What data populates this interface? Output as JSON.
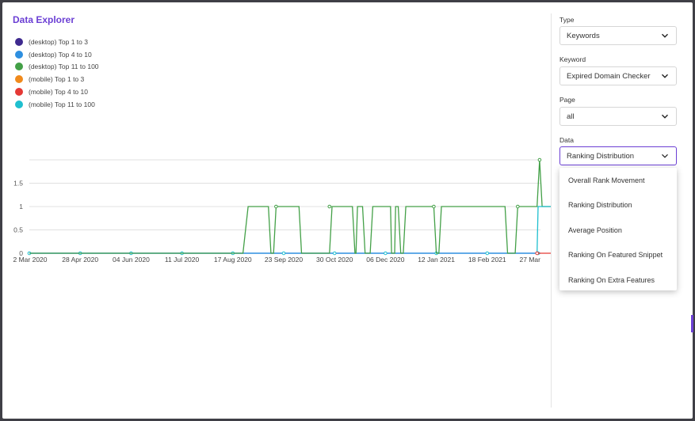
{
  "title": "Data Explorer",
  "legend": [
    {
      "label": "(desktop) Top 1 to 3",
      "color": "#3f2a8f"
    },
    {
      "label": "(desktop) Top 4 to 10",
      "color": "#2e8fe0"
    },
    {
      "label": "(desktop) Top 11 to 100",
      "color": "#43a047"
    },
    {
      "label": "(mobile) Top 1 to 3",
      "color": "#f08a1c"
    },
    {
      "label": "(mobile) Top 4 to 10",
      "color": "#e53935"
    },
    {
      "label": "(mobile) Top 11 to 100",
      "color": "#1fbfcf"
    }
  ],
  "chart_data": {
    "type": "line",
    "ylim": [
      0,
      2
    ],
    "yticks": [
      "0",
      "0.5",
      "1",
      "1.5"
    ],
    "xticks": [
      "2 Mar 2020",
      "28 Apr 2020",
      "04 Jun 2020",
      "11 Jul 2020",
      "17 Aug 2020",
      "23 Sep 2020",
      "30 Oct 2020",
      "06 Dec 2020",
      "12 Jan 2021",
      "18 Feb 2021",
      "27 Mar"
    ],
    "series": [
      {
        "name": "(desktop) Top 11 to 100",
        "color": "#43a047",
        "points": [
          [
            0,
            0
          ],
          [
            4.2,
            0
          ],
          [
            4.3,
            1
          ],
          [
            4.7,
            1
          ],
          [
            4.75,
            0
          ],
          [
            4.8,
            0
          ],
          [
            4.85,
            1
          ],
          [
            5.3,
            1
          ],
          [
            5.35,
            0
          ],
          [
            5.9,
            0
          ],
          [
            5.95,
            1
          ],
          [
            6.35,
            1
          ],
          [
            6.4,
            0
          ],
          [
            6.42,
            0
          ],
          [
            6.45,
            1
          ],
          [
            6.55,
            1
          ],
          [
            6.6,
            0
          ],
          [
            6.7,
            0
          ],
          [
            6.75,
            1
          ],
          [
            7.1,
            1
          ],
          [
            7.12,
            0
          ],
          [
            7.18,
            0
          ],
          [
            7.2,
            1
          ],
          [
            7.25,
            1
          ],
          [
            7.3,
            0
          ],
          [
            7.35,
            0
          ],
          [
            7.4,
            1
          ],
          [
            7.95,
            1
          ],
          [
            8.0,
            0
          ],
          [
            8.05,
            0
          ],
          [
            8.1,
            1
          ],
          [
            9.35,
            1
          ],
          [
            9.4,
            0
          ],
          [
            9.55,
            0
          ],
          [
            9.6,
            1
          ],
          [
            9.98,
            1
          ],
          [
            10.03,
            2
          ],
          [
            10.08,
            1
          ],
          [
            10.4,
            1
          ],
          [
            10.42,
            0
          ],
          [
            10.55,
            0
          ],
          [
            10.6,
            1
          ],
          [
            10.7,
            1
          ]
        ]
      },
      {
        "name": "(mobile) Top 11 to 100",
        "color": "#1fbfcf",
        "points": [
          [
            9.98,
            0
          ],
          [
            10.0,
            1
          ],
          [
            10.3,
            1
          ],
          [
            10.33,
            0
          ],
          [
            10.4,
            0
          ],
          [
            10.42,
            1
          ],
          [
            10.48,
            1
          ],
          [
            10.52,
            0
          ],
          [
            10.65,
            0
          ],
          [
            10.68,
            1
          ],
          [
            11.0,
            1
          ],
          [
            11.05,
            0
          ]
        ]
      },
      {
        "name": "(mobile) Top 4 to 10",
        "color": "#e53935",
        "points": [
          [
            9.98,
            0
          ],
          [
            11.05,
            0
          ]
        ]
      }
    ]
  },
  "sidebar": {
    "type_label": "Type",
    "type_value": "Keywords",
    "keyword_label": "Keyword",
    "keyword_value": "Expired Domain Checker",
    "page_label": "Page",
    "page_value": "all",
    "data_label": "Data",
    "data_value": "Ranking Distribution"
  },
  "dropdown": {
    "options": [
      "Overall Rank Movement",
      "Ranking Distribution",
      "Average Position",
      "Ranking On Featured Snippet",
      "Ranking On Extra Features"
    ]
  }
}
